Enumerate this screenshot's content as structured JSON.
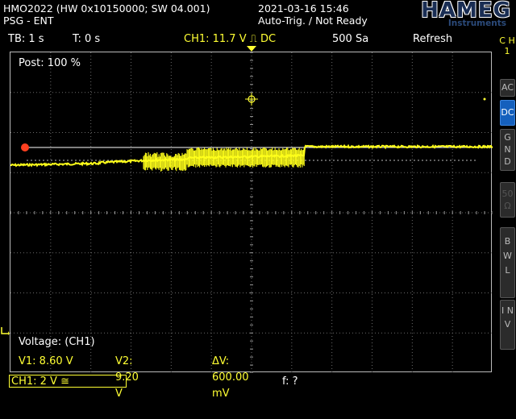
{
  "header": {
    "device": "HMO2022 (HW 0x10150000; SW 04.001)",
    "mode": "PSG - ENT",
    "datetime": "2021-03-16 15:46",
    "trigger_status": "Auto-Trig. / Not Ready",
    "logo": "HAMEG",
    "logo_sub": "Instruments"
  },
  "info_bar": {
    "timebase": "TB: 1 s",
    "time": "T: 0 s",
    "trigger": "CH1: 11.7 V ⎍ DC",
    "samples": "500 Sa",
    "acq_mode": "Refresh"
  },
  "screen": {
    "post": "Post: 100 %",
    "cursor_title": "Voltage: (CH1)",
    "v1": "V1: 8.60 V",
    "v2": "V2: 9.20 V",
    "dv": "ΔV: 600.00 mV"
  },
  "right_panel": {
    "ch_tab": "C H 1",
    "ac": "AC",
    "dc": "DC",
    "gnd": "G N D",
    "ohm": "50 Ω",
    "bwl": "B W L",
    "inv": "I N V"
  },
  "bottom": {
    "ch_scale": "CH1: 2 V ≅",
    "freq": "f: ?"
  },
  "colors": {
    "trace": "#ffff1a",
    "accent": "#1560bd",
    "grid": "#6a6a6a",
    "marker": "#ff4020"
  }
}
